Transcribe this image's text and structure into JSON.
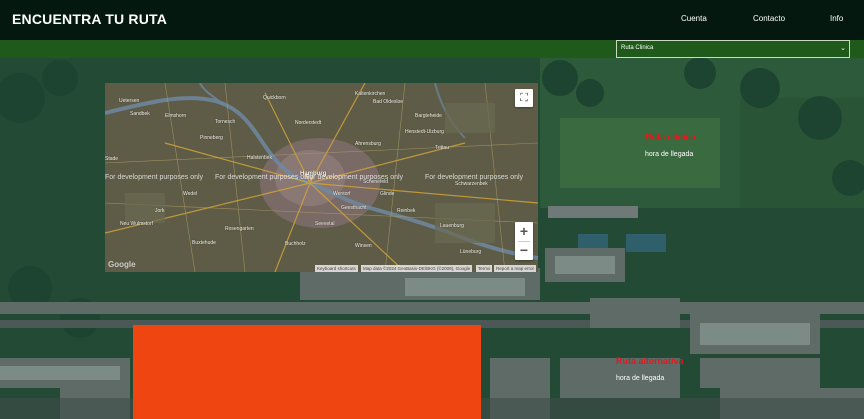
{
  "header": {
    "brand": "ENCUENTRA TU RUTA",
    "nav": [
      {
        "label": "Cuenta"
      },
      {
        "label": "Contacto"
      },
      {
        "label": "Info"
      }
    ]
  },
  "route_select": {
    "value": "Ruta Clinica"
  },
  "map": {
    "dev_watermark": "For development purposes only",
    "google_logo": "Google",
    "attribution": {
      "shortcuts": "Keyboard shortcuts",
      "data": "Map data ©2024 GeoBasis-DE/BKG (©2009), Google",
      "terms": "Terms",
      "report": "Report a map error"
    },
    "cities": [
      "Uetersen",
      "Sandbek",
      "Schenefeld",
      "Hamburg",
      "Wedel",
      "Halstenbek",
      "Norderstedt",
      "Kaltenkirchen",
      "Ahrensburg",
      "Bargteheide",
      "Reinbek",
      "Geesthacht",
      "Buxtehude",
      "Stade",
      "Buchholz",
      "Seevetal",
      "Winsen",
      "Glinde",
      "Trittau",
      "Elmshorn",
      "Quickborn",
      "Pinneberg",
      "Tornesch",
      "Bad Oldesloe",
      "Schwarzenbek",
      "Lauenburg",
      "Henstedt-Ulzburg",
      "Wentorf",
      "Neu Wulmstorf",
      "Jork",
      "Rosengarten",
      "Lüneburg"
    ]
  },
  "routes": [
    {
      "title": "Ruta clinica",
      "time_label": "hora de llegada"
    },
    {
      "title": "Ruta alternativa",
      "time_label": "hora de llegada"
    }
  ],
  "colors": {
    "header_bg": "#041810",
    "strip_bg": "#1f5a1a",
    "route_title": "#e8161b",
    "orange_block": "#ef4511"
  }
}
